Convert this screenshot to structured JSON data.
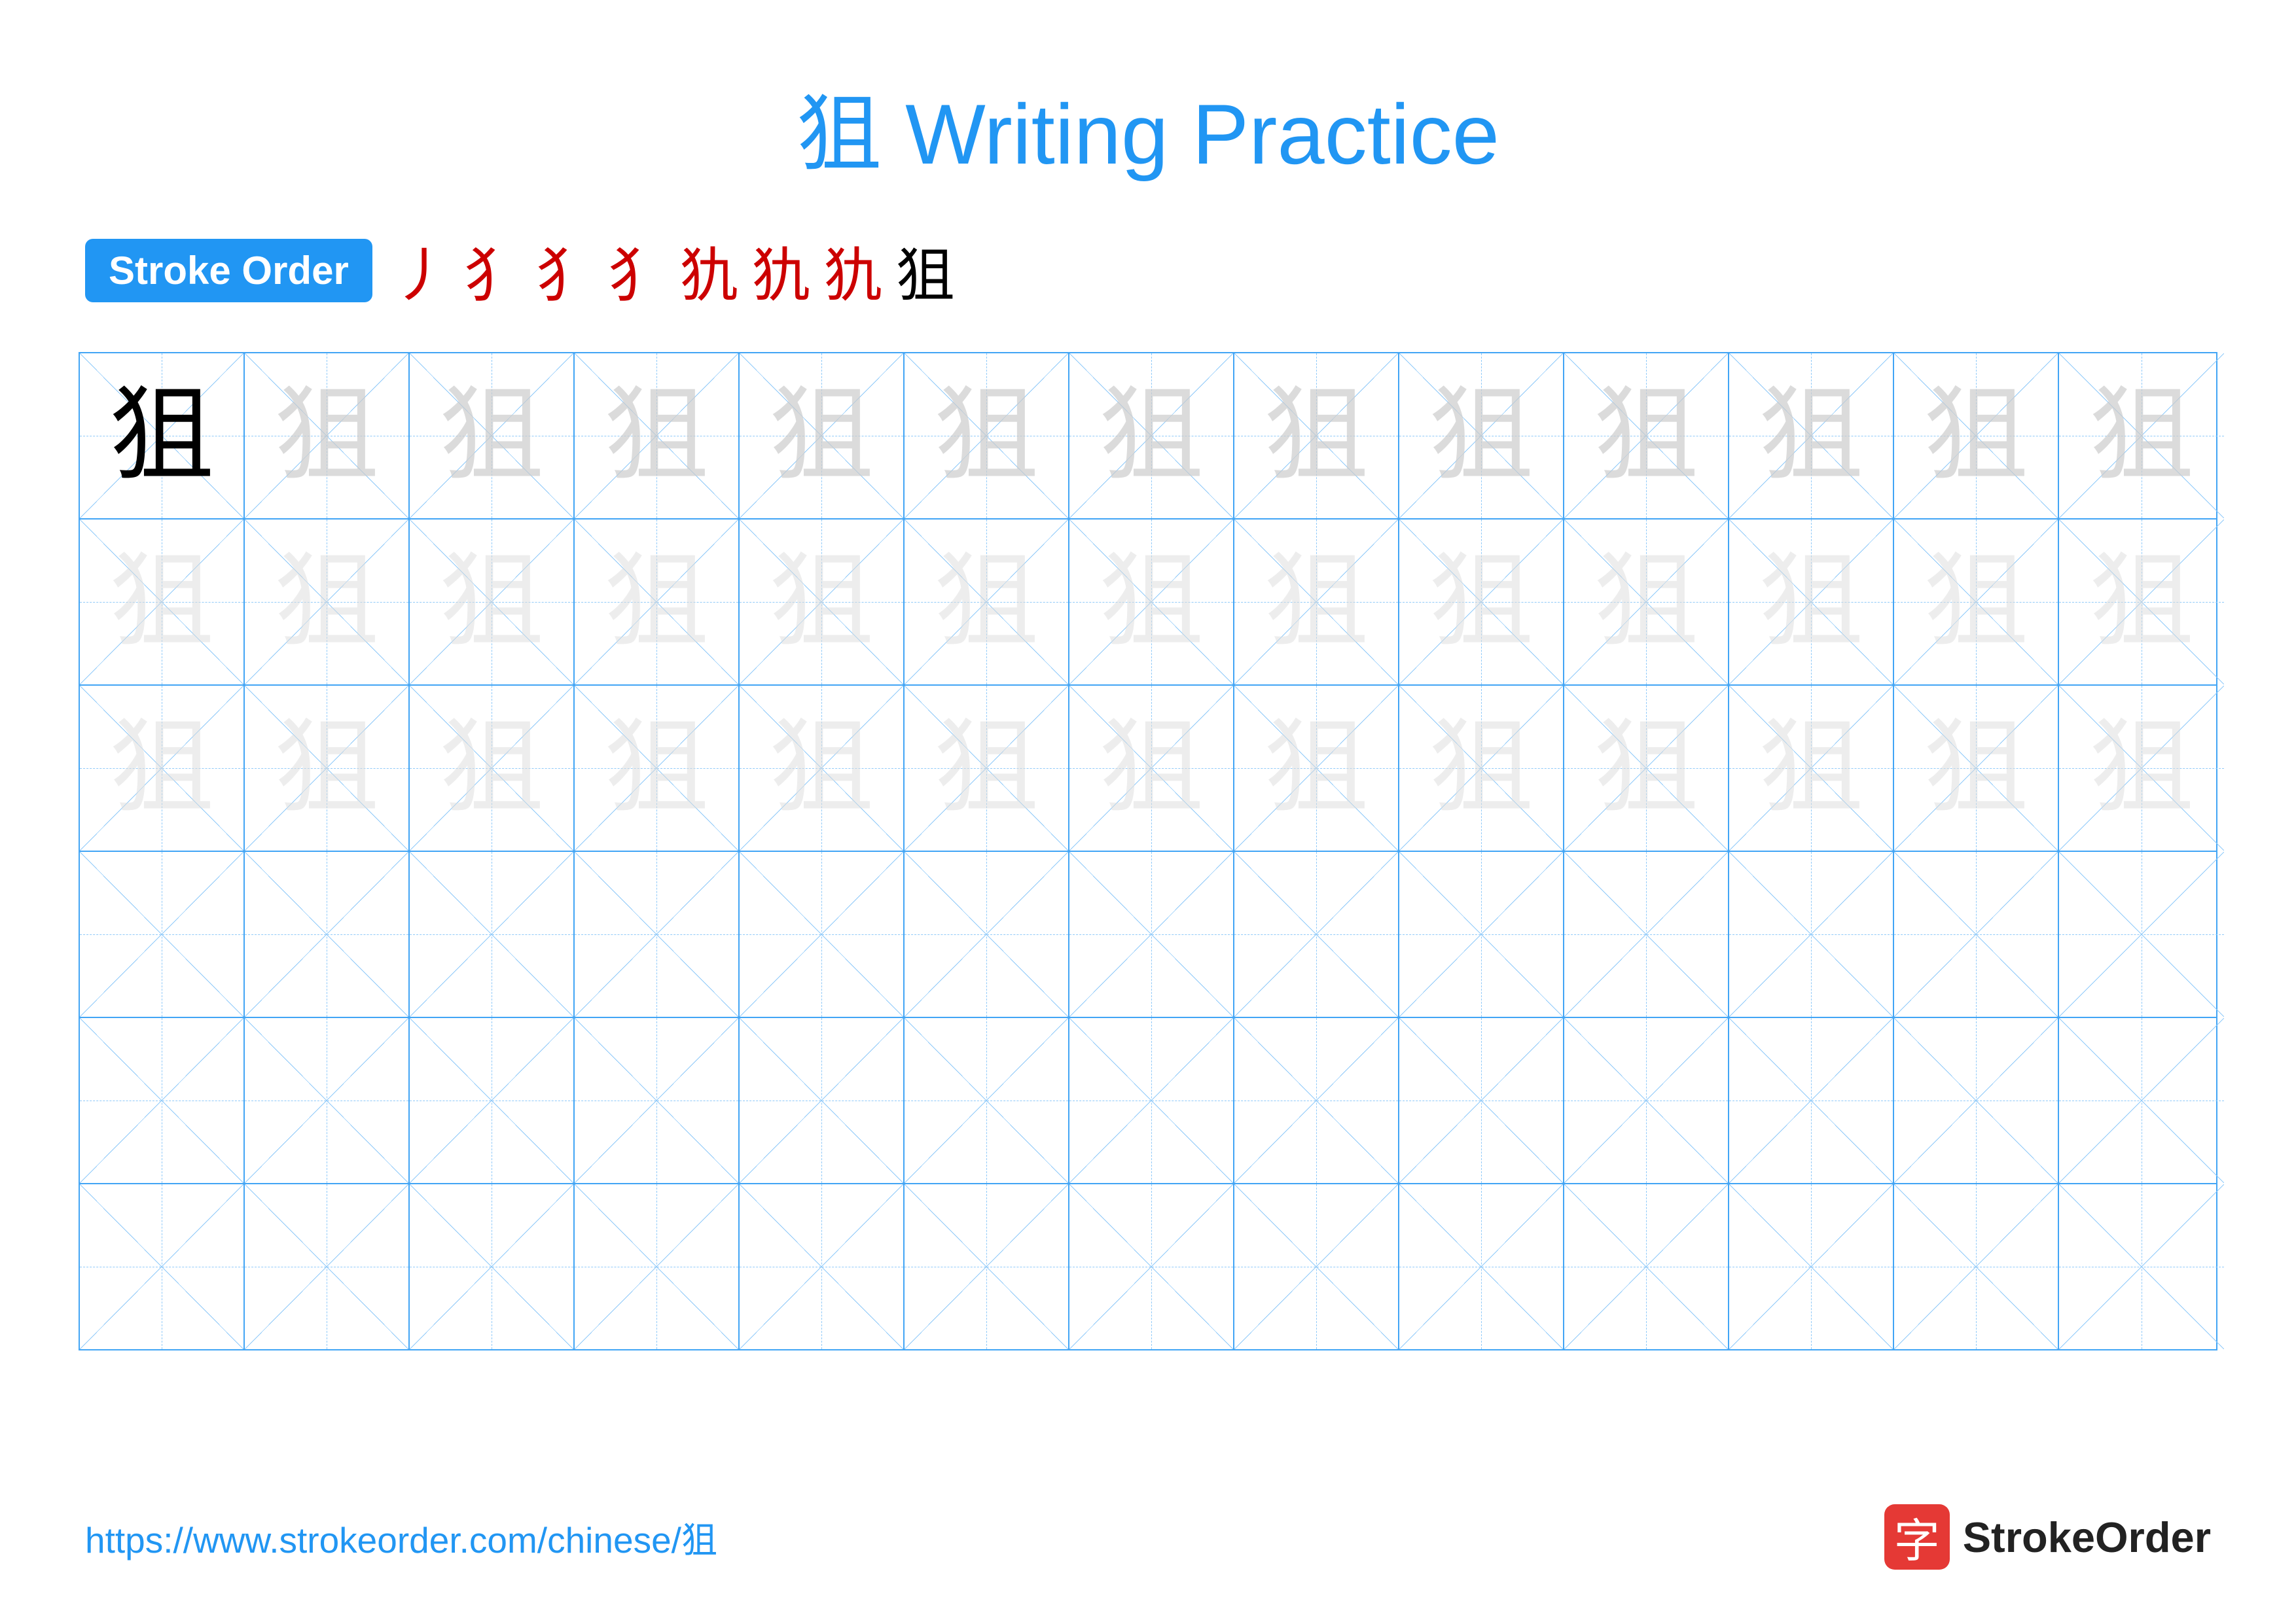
{
  "title": {
    "text": "狙 Writing Practice",
    "color": "#2196F3"
  },
  "strokeOrder": {
    "badge": "Stroke Order",
    "strokes": [
      "丿",
      "犭",
      "犭",
      "犭",
      "犰",
      "犰",
      "犰",
      "狙"
    ],
    "finalStroke": "狙"
  },
  "character": "狙",
  "rows": [
    {
      "type": "dark-then-light",
      "darkCount": 1,
      "lightCount": 12
    },
    {
      "type": "lighter",
      "count": 13
    },
    {
      "type": "lighter",
      "count": 13
    },
    {
      "type": "empty",
      "count": 13
    },
    {
      "type": "empty",
      "count": 13
    },
    {
      "type": "empty",
      "count": 13
    }
  ],
  "footer": {
    "url": "https://www.strokeorder.com/chinese/狙",
    "logoChar": "字",
    "logoText": "StrokeOrder"
  }
}
